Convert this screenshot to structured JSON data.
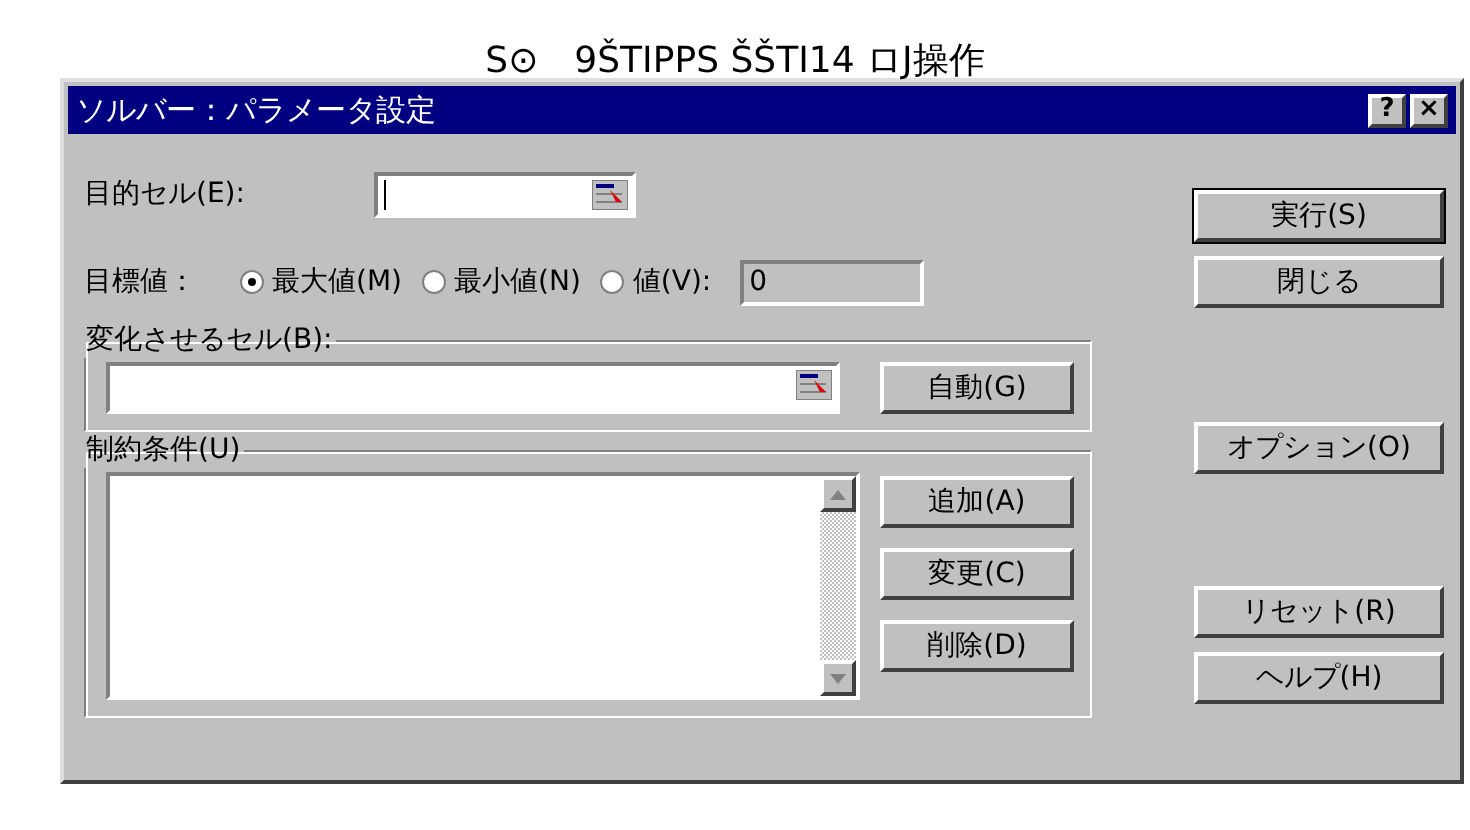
{
  "caption": "S⊙　9ŠTIPPS ŠŠTI14 ロJ操作",
  "window": {
    "title": "ソルバー：パラメータ設定",
    "title_buttons": [
      "?",
      "×"
    ]
  },
  "target_cell": {
    "label": "目的セル(E):"
  },
  "goal": {
    "label": "目標値：",
    "options": [
      {
        "label": "最大値(M)",
        "selected": true
      },
      {
        "label": "最小値(N)",
        "selected": false
      },
      {
        "label": "値(V):",
        "selected": false
      }
    ],
    "value": "0"
  },
  "changing_cells": {
    "label": "変化させるセル(B):",
    "button": "自動(G)"
  },
  "constraints": {
    "label": "制約条件(U)",
    "buttons": [
      "追加(A)",
      "変更(C)",
      "削除(D)"
    ]
  },
  "side_buttons": [
    [
      "実行(S)",
      "閉じる"
    ],
    [
      "オプション(O)"
    ],
    [
      "リセット(R)",
      "ヘルプ(H)"
    ]
  ]
}
